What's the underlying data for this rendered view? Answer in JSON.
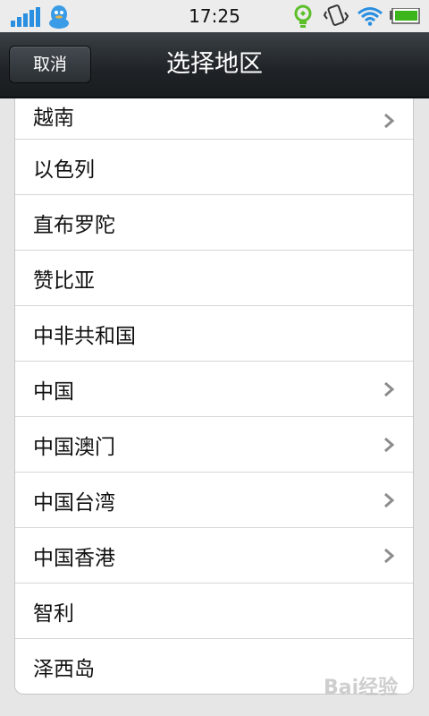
{
  "status_bar": {
    "time": "17:25",
    "icons": [
      "signal-icon",
      "qq-penguin-icon",
      "lightbulb-icon",
      "vibrate-icon",
      "wifi-icon",
      "battery-icon"
    ]
  },
  "nav": {
    "cancel_label": "取消",
    "title": "选择地区"
  },
  "regions": [
    {
      "name": "越南",
      "has_children": true
    },
    {
      "name": "以色列",
      "has_children": false
    },
    {
      "name": "直布罗陀",
      "has_children": false
    },
    {
      "name": "赞比亚",
      "has_children": false
    },
    {
      "name": "中非共和国",
      "has_children": false
    },
    {
      "name": "中国",
      "has_children": true
    },
    {
      "name": "中国澳门",
      "has_children": true
    },
    {
      "name": "中国台湾",
      "has_children": true
    },
    {
      "name": "中国香港",
      "has_children": true
    },
    {
      "name": "智利",
      "has_children": false
    },
    {
      "name": "泽西岛",
      "has_children": false
    }
  ],
  "watermark": "Bai经验",
  "colors": {
    "nav_bg": "#1f2327",
    "signal_blue": "#2a8fe0",
    "battery_green": "#3bb51b",
    "chevron": "#8c8c8c"
  }
}
